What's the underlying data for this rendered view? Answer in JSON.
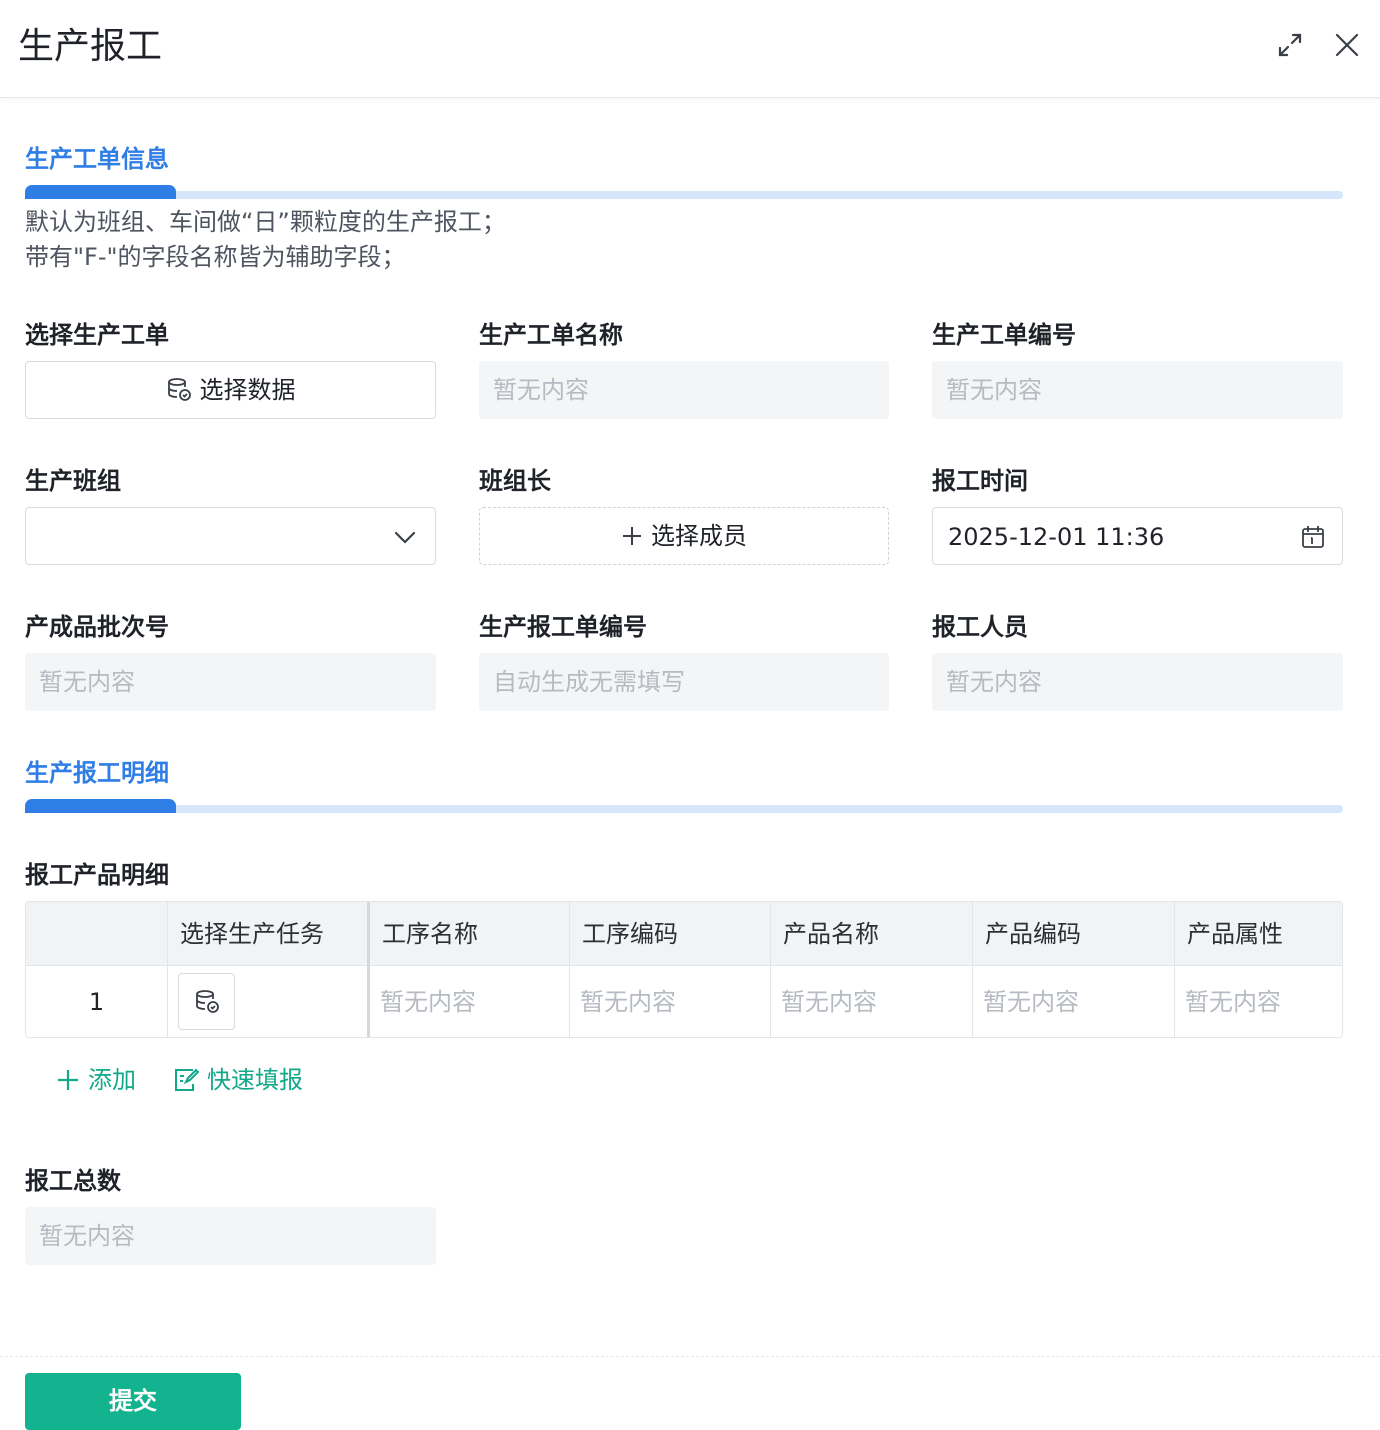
{
  "header": {
    "title": "生产报工"
  },
  "section1": {
    "title": "生产工单信息",
    "desc_line1": "默认为班组、车间做“日”颗粒度的生产报工；",
    "desc_line2": "带有\"F-\"的字段名称皆为辅助字段；"
  },
  "fields": {
    "select_order": {
      "label": "选择生产工单",
      "button": "选择数据"
    },
    "order_name": {
      "label": "生产工单名称",
      "value": "暂无内容"
    },
    "order_no": {
      "label": "生产工单编号",
      "value": "暂无内容"
    },
    "team": {
      "label": "生产班组",
      "value": ""
    },
    "team_leader": {
      "label": "班组长",
      "button": "选择成员"
    },
    "report_time": {
      "label": "报工时间",
      "value": "2025-12-01 11:36"
    },
    "batch_no": {
      "label": "产成品批次号",
      "value": "暂无内容"
    },
    "report_no": {
      "label": "生产报工单编号",
      "value": "自动生成无需填写"
    },
    "reporter": {
      "label": "报工人员",
      "value": "暂无内容"
    }
  },
  "section2": {
    "title": "生产报工明细"
  },
  "detail": {
    "label": "报工产品明细",
    "columns": [
      "选择生产任务",
      "工序名称",
      "工序编码",
      "产品名称",
      "产品编码",
      "产品属性"
    ],
    "rows": [
      {
        "index": "1",
        "cells": [
          "暂无内容",
          "暂无内容",
          "暂无内容",
          "暂无内容",
          "暂无内容"
        ]
      }
    ],
    "add_label": "添加",
    "quick_fill_label": "快速填报"
  },
  "total": {
    "label": "报工总数",
    "value": "暂无内容"
  },
  "submit_label": "提交",
  "colors": {
    "primary": "#2f7ee6",
    "accent_green": "#14b38f",
    "link_green": "#12a88a"
  }
}
